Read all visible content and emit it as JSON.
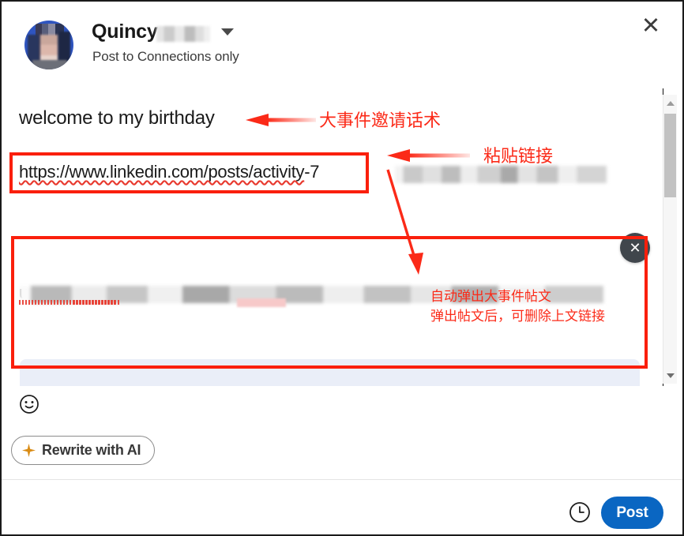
{
  "window": {
    "close_label": "✕"
  },
  "header": {
    "author_name": "Quincy",
    "author_name_redacted": true,
    "visibility": "Post to Connections only",
    "dropdown_icon": "chevron-down-icon",
    "avatar_icon": "avatar"
  },
  "editor": {
    "post_text": "welcome to my birthday",
    "url_text": "https://www.linkedin.com/posts/activity",
    "url_suffix_visible": "-7",
    "url_line2_visible": "u",
    "preview_close_label": "✕",
    "preview_placeholder": ""
  },
  "toolbar": {
    "emoji_icon": "emoji-smiley-icon",
    "rewrite_label": "Rewrite with AI",
    "sparkle_icon": "sparkle-icon"
  },
  "footer": {
    "schedule_icon": "clock-icon",
    "post_label": "Post"
  },
  "scrollbar": {
    "up_icon": "triangle-up-icon",
    "down_icon": "triangle-down-icon"
  },
  "annotations": {
    "color": "#fb2a18",
    "a1_text": "大事件邀请话术",
    "a2_text": "粘贴链接",
    "a3_line1": "自动弹出大事件帖文",
    "a3_line2": "弹出帖文后，可删除上文链接"
  },
  "colors": {
    "post_button": "#0a66c2",
    "annotation_red": "#fb2a18",
    "preview_bg": "#eaeef8",
    "sparkle_orange": "#d98c16"
  }
}
